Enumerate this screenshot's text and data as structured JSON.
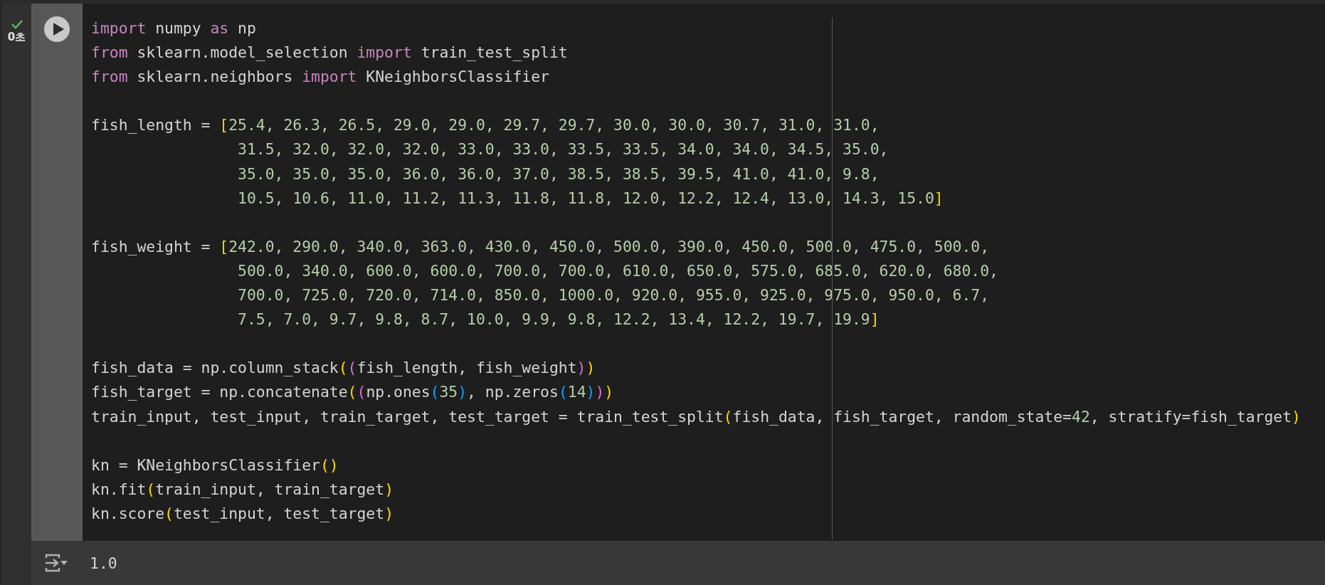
{
  "cell": {
    "status": {
      "done": true,
      "time": "0초"
    },
    "code_lines": [
      {
        "kind": "code",
        "tokens": [
          {
            "t": "import",
            "kind": "keyword"
          },
          {
            "t": " numpy ",
            "kind": "plain"
          },
          {
            "t": "as",
            "kind": "keyword"
          },
          {
            "t": " np",
            "kind": "plain"
          }
        ]
      },
      {
        "kind": "code",
        "tokens": [
          {
            "t": "from",
            "kind": "keyword"
          },
          {
            "t": " sklearn.model_selection ",
            "kind": "plain"
          },
          {
            "t": "import",
            "kind": "keyword"
          },
          {
            "t": " train_test_split",
            "kind": "plain"
          }
        ]
      },
      {
        "kind": "code",
        "tokens": [
          {
            "t": "from",
            "kind": "keyword"
          },
          {
            "t": " sklearn.neighbors ",
            "kind": "plain"
          },
          {
            "t": "import",
            "kind": "keyword"
          },
          {
            "t": " KNeighborsClassifier",
            "kind": "plain"
          }
        ]
      },
      {
        "kind": "blank"
      },
      {
        "kind": "code",
        "tokens": [
          {
            "t": "fish_length = ",
            "kind": "plain"
          },
          {
            "t": "[",
            "kind": "bracket"
          },
          {
            "t": "25.4, 26.3, 26.5, 29.0, 29.0, 29.7, 29.7, 30.0, 30.0, 30.7, 31.0, 31.0,",
            "kind": "number"
          }
        ]
      },
      {
        "kind": "code",
        "tokens": [
          {
            "t": "                31.5, 32.0, 32.0, 32.0, 33.0, 33.0, 33.5, 33.5, 34.0, 34.0, 34.5, 35.0,",
            "kind": "number"
          }
        ]
      },
      {
        "kind": "code",
        "tokens": [
          {
            "t": "                35.0, 35.0, 35.0, 36.0, 36.0, 37.0, 38.5, 38.5, 39.5, 41.0, 41.0, 9.8,",
            "kind": "number"
          }
        ]
      },
      {
        "kind": "code",
        "tokens": [
          {
            "t": "                10.5, 10.6, 11.0, 11.2, 11.3, 11.8, 11.8, 12.0, 12.2, 12.4, 13.0, 14.3, 15.0",
            "kind": "number"
          },
          {
            "t": "]",
            "kind": "bracket"
          }
        ]
      },
      {
        "kind": "blank"
      },
      {
        "kind": "code",
        "tokens": [
          {
            "t": "fish_weight = ",
            "kind": "plain"
          },
          {
            "t": "[",
            "kind": "bracket"
          },
          {
            "t": "242.0, 290.0, 340.0, 363.0, 430.0, 450.0, 500.0, 390.0, 450.0, 500.0, 475.0, 500.0,",
            "kind": "number"
          }
        ]
      },
      {
        "kind": "code",
        "tokens": [
          {
            "t": "                500.0, 340.0, 600.0, 600.0, 700.0, 700.0, 610.0, 650.0, 575.0, 685.0, 620.0, 680.0,",
            "kind": "number"
          }
        ]
      },
      {
        "kind": "code",
        "tokens": [
          {
            "t": "                700.0, 725.0, 720.0, 714.0, 850.0, 1000.0, 920.0, 955.0, 925.0, 975.0, 950.0, 6.7,",
            "kind": "number"
          }
        ]
      },
      {
        "kind": "code",
        "tokens": [
          {
            "t": "                7.5, 7.0, 9.7, 9.8, 8.7, 10.0, 9.9, 9.8, 12.2, 13.4, 12.2, 19.7, 19.9",
            "kind": "number"
          },
          {
            "t": "]",
            "kind": "bracket"
          }
        ]
      },
      {
        "kind": "blank"
      },
      {
        "kind": "code",
        "tokens": [
          {
            "t": "fish_data = np.column_stack",
            "kind": "plain"
          },
          {
            "t": "(",
            "kind": "bracket"
          },
          {
            "t": "(",
            "kind": "bracket2"
          },
          {
            "t": "fish_length, fish_weight",
            "kind": "plain"
          },
          {
            "t": ")",
            "kind": "bracket2"
          },
          {
            "t": ")",
            "kind": "bracket"
          }
        ]
      },
      {
        "kind": "code",
        "tokens": [
          {
            "t": "fish_target = np.concatenate",
            "kind": "plain"
          },
          {
            "t": "(",
            "kind": "bracket"
          },
          {
            "t": "(",
            "kind": "bracket2"
          },
          {
            "t": "np.ones",
            "kind": "plain"
          },
          {
            "t": "(",
            "kind": "bracket3"
          },
          {
            "t": "35",
            "kind": "number"
          },
          {
            "t": ")",
            "kind": "bracket3"
          },
          {
            "t": ", np.zeros",
            "kind": "plain"
          },
          {
            "t": "(",
            "kind": "bracket3"
          },
          {
            "t": "14",
            "kind": "number"
          },
          {
            "t": ")",
            "kind": "bracket3"
          },
          {
            "t": ")",
            "kind": "bracket2"
          },
          {
            "t": ")",
            "kind": "bracket"
          }
        ]
      },
      {
        "kind": "code",
        "tokens": [
          {
            "t": "train_input, test_input, train_target, test_target = train_test_split",
            "kind": "plain"
          },
          {
            "t": "(",
            "kind": "bracket"
          },
          {
            "t": "fish_data, fish_target, random_state=",
            "kind": "plain"
          },
          {
            "t": "42",
            "kind": "number"
          },
          {
            "t": ", stratify=fish_target",
            "kind": "plain"
          },
          {
            "t": ")",
            "kind": "bracket"
          }
        ]
      },
      {
        "kind": "blank"
      },
      {
        "kind": "code",
        "tokens": [
          {
            "t": "kn = KNeighborsClassifier",
            "kind": "plain"
          },
          {
            "t": "()",
            "kind": "bracket"
          }
        ]
      },
      {
        "kind": "code",
        "tokens": [
          {
            "t": "kn.fit",
            "kind": "plain"
          },
          {
            "t": "(",
            "kind": "bracket"
          },
          {
            "t": "train_input, train_target",
            "kind": "plain"
          },
          {
            "t": ")",
            "kind": "bracket"
          }
        ]
      },
      {
        "kind": "code",
        "tokens": [
          {
            "t": "kn.score",
            "kind": "plain"
          },
          {
            "t": "(",
            "kind": "bracket"
          },
          {
            "t": "test_input, test_target",
            "kind": "plain"
          },
          {
            "t": ")",
            "kind": "bracket"
          }
        ]
      }
    ],
    "output": {
      "text": "1.0"
    }
  }
}
